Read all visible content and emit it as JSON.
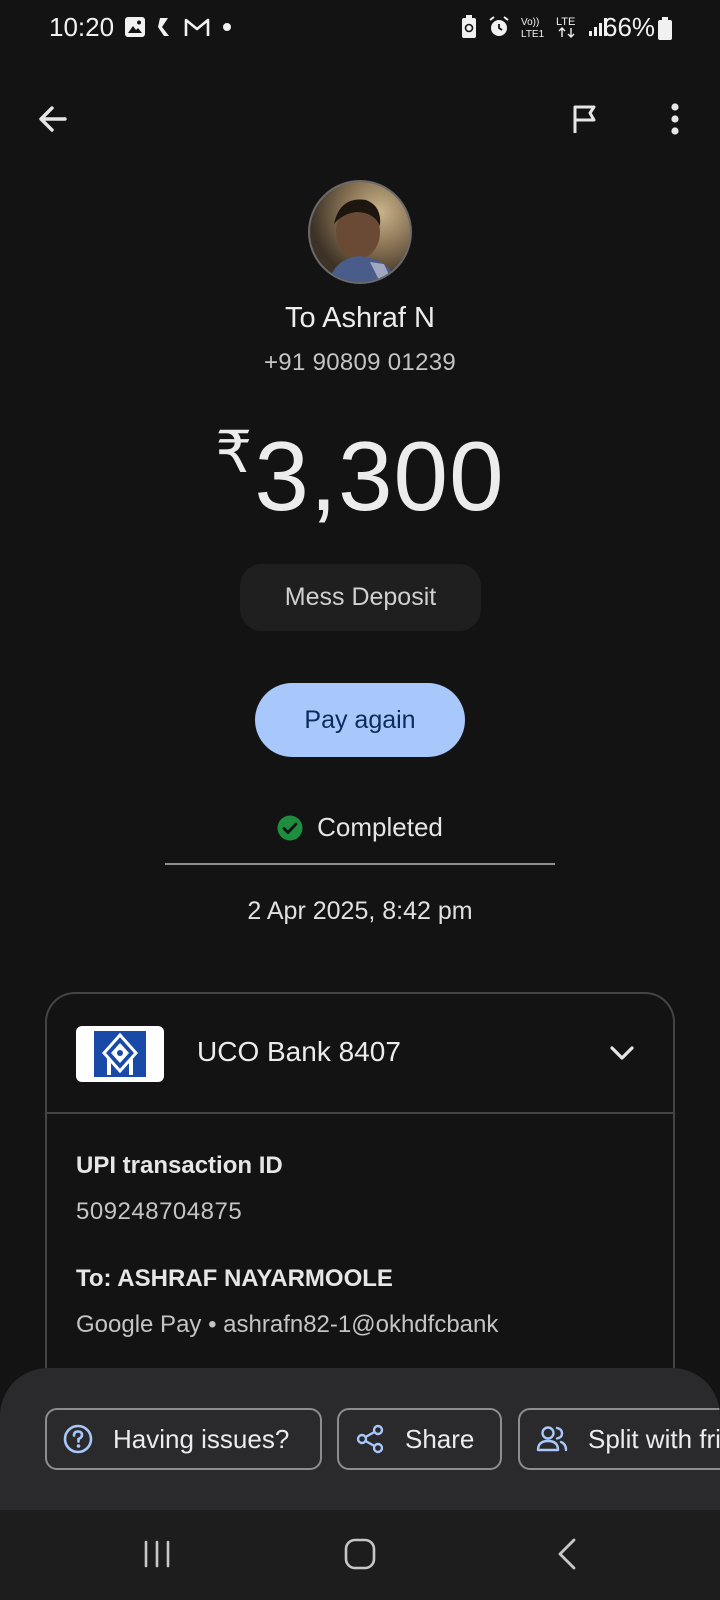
{
  "status_bar": {
    "time": "10:20",
    "battery": "66%",
    "network": "LTE",
    "volte": "Vo) LTE1"
  },
  "recipient": {
    "name": "To Ashraf N",
    "phone": "+91 90809 01239"
  },
  "amount": {
    "currency": "₹",
    "value": "3,300"
  },
  "note": "Mess Deposit",
  "pay_again_label": "Pay again",
  "status": {
    "label": "Completed",
    "color": "#1e8e3e"
  },
  "datetime": "2 Apr 2025, 8:42 pm",
  "details": {
    "bank_name": "UCO Bank 8407",
    "upi_label": "UPI transaction ID",
    "upi_id": "509248704875",
    "to_label": "To: ASHRAF NAYARMOOLE",
    "to_value": "Google Pay • ashrafn82-1@okhdfcbank"
  },
  "actions": {
    "issues": "Having issues?",
    "share": "Share",
    "split": "Split with friends"
  },
  "colors": {
    "background": "#131314",
    "accent": "#a8c7fa",
    "bank_logo": "#1a4aa8"
  }
}
